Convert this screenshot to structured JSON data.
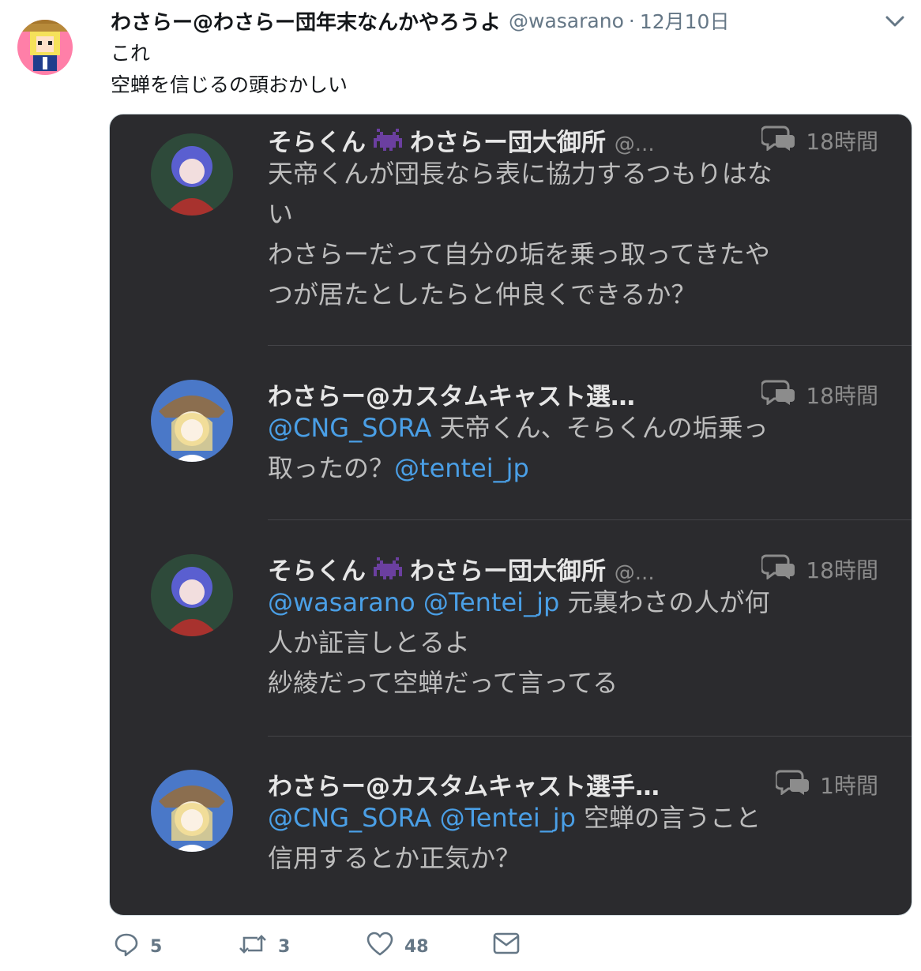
{
  "tweet": {
    "display_name": "わさらー@わさらー団年末なんかやろうよ",
    "handle": "@wasarano",
    "separator": "·",
    "date": "12月10日",
    "lines": [
      "これ",
      "空蝉を信じるの頭おかしい"
    ]
  },
  "screenshot": {
    "replies": [
      {
        "name": "そらくん",
        "name_suffix": "わさらー団大御所",
        "handle": "@...",
        "time": "18時間",
        "lines": [
          {
            "parts": [
              {
                "t": "天帝くんが団長なら表に協力するつもりはな",
                "m": false
              }
            ]
          },
          {
            "parts": [
              {
                "t": "い",
                "m": false
              }
            ]
          },
          {
            "parts": [
              {
                "t": "わさらーだって自分の垢を乗っ取ってきたや",
                "m": false
              }
            ]
          },
          {
            "parts": [
              {
                "t": "つが居たとしたらと仲良くできるか？",
                "m": false
              }
            ]
          }
        ]
      },
      {
        "name": "わさらー@カスタムキャスト選…",
        "name_suffix": "",
        "handle": "",
        "time": "18時間",
        "lines": [
          {
            "parts": [
              {
                "t": "@CNG_SORA",
                "m": true
              },
              {
                "t": " 天帝くん、そらくんの垢乗っ",
                "m": false
              }
            ]
          },
          {
            "parts": [
              {
                "t": "取ったの？",
                "m": false
              },
              {
                "t": "@tentei_jp",
                "m": true
              }
            ]
          }
        ]
      },
      {
        "name": "そらくん",
        "name_suffix": "わさらー団大御所",
        "handle": "@...",
        "time": "18時間",
        "lines": [
          {
            "parts": [
              {
                "t": "@wasarano @Tentei_jp",
                "m": true
              },
              {
                "t": " 元裏わさの人が何",
                "m": false
              }
            ]
          },
          {
            "parts": [
              {
                "t": "人か証言しとるよ",
                "m": false
              }
            ]
          },
          {
            "parts": [
              {
                "t": "紗綾だって空蝉だって言ってる",
                "m": false
              }
            ]
          }
        ]
      },
      {
        "name": "わさらー@カスタムキャスト選手…",
        "name_suffix": "",
        "handle": "",
        "time": "1時間",
        "lines": [
          {
            "parts": [
              {
                "t": "@CNG_SORA @Tentei_jp",
                "m": true
              },
              {
                "t": " 空蝉の言うこと",
                "m": false
              }
            ]
          },
          {
            "parts": [
              {
                "t": "信用するとか正気か？",
                "m": false
              }
            ]
          }
        ]
      }
    ]
  },
  "actions": {
    "replies": "5",
    "retweets": "3",
    "likes": "48"
  },
  "colors": {
    "mention": "#4a9fe6",
    "dark_bg": "#2b2b2e",
    "muted": "#657786"
  }
}
